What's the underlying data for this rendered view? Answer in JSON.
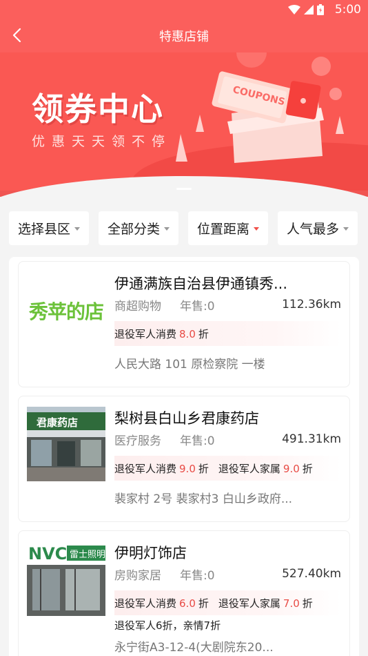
{
  "status_bar": {
    "time": "5:00"
  },
  "header": {
    "title": "特惠店铺"
  },
  "banner": {
    "title": "领券中心",
    "subtitle": "优惠天天领不停",
    "coupon_text": "COUPONS"
  },
  "filters": [
    {
      "label": "选择县区",
      "active": false
    },
    {
      "label": "全部分类",
      "active": false
    },
    {
      "label": "位置距离",
      "active": true
    },
    {
      "label": "人气最多",
      "active": false
    }
  ],
  "shops": [
    {
      "name": "伊通满族自治县伊通镇秀...",
      "logo_text": "秀苹的店",
      "category": "商超购物",
      "sales": "年售:0",
      "distance": "112.36km",
      "discounts": [
        {
          "label": "退役军人消费",
          "value": "8.0",
          "unit": "折"
        }
      ],
      "note": "",
      "address": "人民大路 101 原检察院 一楼"
    },
    {
      "name": "梨树县白山乡君康药店",
      "category": "医疗服务",
      "sales": "年售:0",
      "distance": "491.31km",
      "discounts": [
        {
          "label": "退役军人消费",
          "value": "9.0",
          "unit": "折"
        },
        {
          "label": "退役军人家属",
          "value": "9.0",
          "unit": "折"
        }
      ],
      "note": "",
      "address": "裴家村 2号 裴家村3 白山乡政府..."
    },
    {
      "name": "伊明灯饰店",
      "category": "房购家居",
      "sales": "年售:0",
      "distance": "527.40km",
      "discounts": [
        {
          "label": "退役军人消费",
          "value": "6.0",
          "unit": "折"
        },
        {
          "label": "退役军人家属",
          "value": "7.0",
          "unit": "折"
        }
      ],
      "note": "退役军人6折，亲情7折",
      "address": "永宁街A3-12-4(大剧院东20..."
    }
  ],
  "colors": {
    "primary": "#fb5f5c",
    "accent": "#e84b45"
  }
}
